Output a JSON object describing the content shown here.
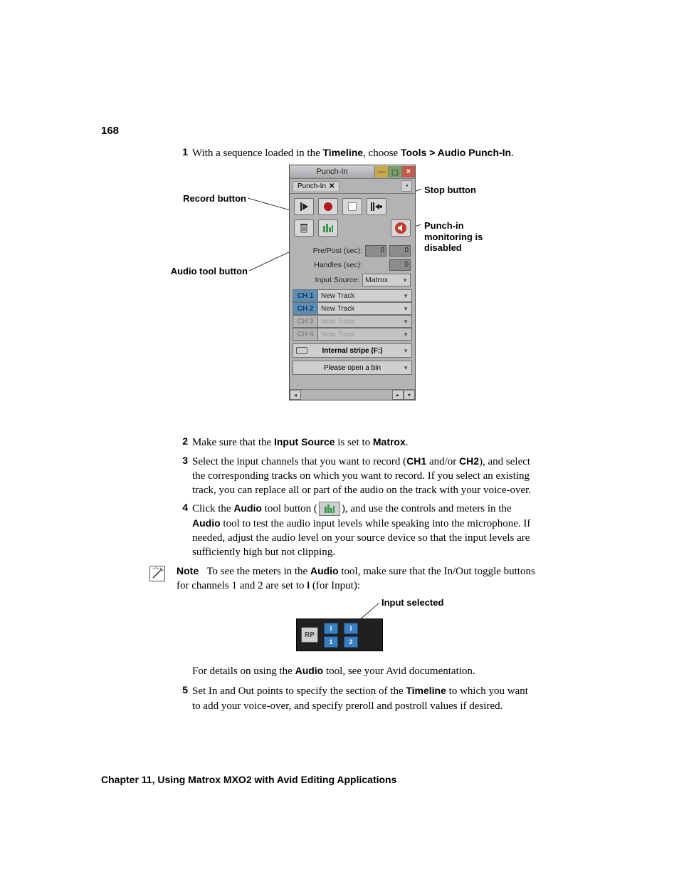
{
  "page_number": "168",
  "steps": {
    "s1": {
      "num": "1",
      "pre": "With a sequence loaded in the ",
      "b1": "Timeline",
      "mid": ", choose ",
      "b2": "Tools > Audio Punch-In",
      "post": "."
    },
    "s2": {
      "num": "2",
      "pre": "Make sure that the ",
      "b1": "Input Source",
      "mid": " is set to ",
      "b2": "Matrox",
      "post": "."
    },
    "s3": {
      "num": "3",
      "pre": "Select the input channels that you want to record (",
      "b1": "CH1",
      "mid1": " and/or ",
      "b2": "CH2",
      "post": "), and select the corresponding tracks on which you want to record. If you select an existing track, you can replace all or part of the audio on the track with your voice-over."
    },
    "s4": {
      "num": "4",
      "pre": "Click the ",
      "b1": "Audio",
      "mid1": " tool button (",
      "mid2": "), and use the controls and meters in the ",
      "b2": "Audio",
      "post": " tool to test the audio input levels while speaking into the microphone. If needed, adjust the audio level on your source device so that the input levels are sufficiently high but not clipping."
    },
    "note": {
      "label": "Note",
      "pre": "To see the meters in the ",
      "b1": "Audio",
      "mid": " tool, make sure that the In/Out toggle buttons for channels 1 and 2 are set to ",
      "b2": "I",
      "post": " (for Input):"
    },
    "detail": {
      "pre": "For details on using the ",
      "b1": "Audio",
      "post": " tool, see your Avid documentation."
    },
    "s5": {
      "num": "5",
      "pre": "Set In and Out points to specify the section of the ",
      "b1": "Timeline",
      "post": " to which you want to add your voice-over, and specify preroll and postroll values if desired."
    }
  },
  "callouts": {
    "record": "Record button",
    "audiotool": "Audio tool button",
    "stop": "Stop button",
    "monitor": "Punch-in monitoring is disabled",
    "input_selected": "Input selected"
  },
  "punchin": {
    "title": "Punch-In",
    "tab": "Punch-In",
    "prepost_label": "Pre/Post (sec):",
    "prepost_v1": "0",
    "prepost_v2": "0",
    "handles_label": "Handles (sec):",
    "handles_v": "0",
    "inputsrc_label": "Input Source:",
    "inputsrc_val": "Matrox",
    "channels": [
      {
        "ch": "CH 1",
        "trk": "New Track",
        "active": true
      },
      {
        "ch": "CH 2",
        "trk": "New Track",
        "active": true
      },
      {
        "ch": "CH 3",
        "trk": "New Track",
        "active": false
      },
      {
        "ch": "CH 4",
        "trk": "New Track",
        "active": false
      }
    ],
    "drive": "Internal stripe (F:)",
    "bin": "Please open a bin"
  },
  "input_panel": {
    "rp": "RP",
    "c1_top": "I",
    "c1_bot": "1",
    "c2_top": "I",
    "c2_bot": "2"
  },
  "footer": "Chapter 11, Using Matrox MXO2 with Avid Editing Applications"
}
